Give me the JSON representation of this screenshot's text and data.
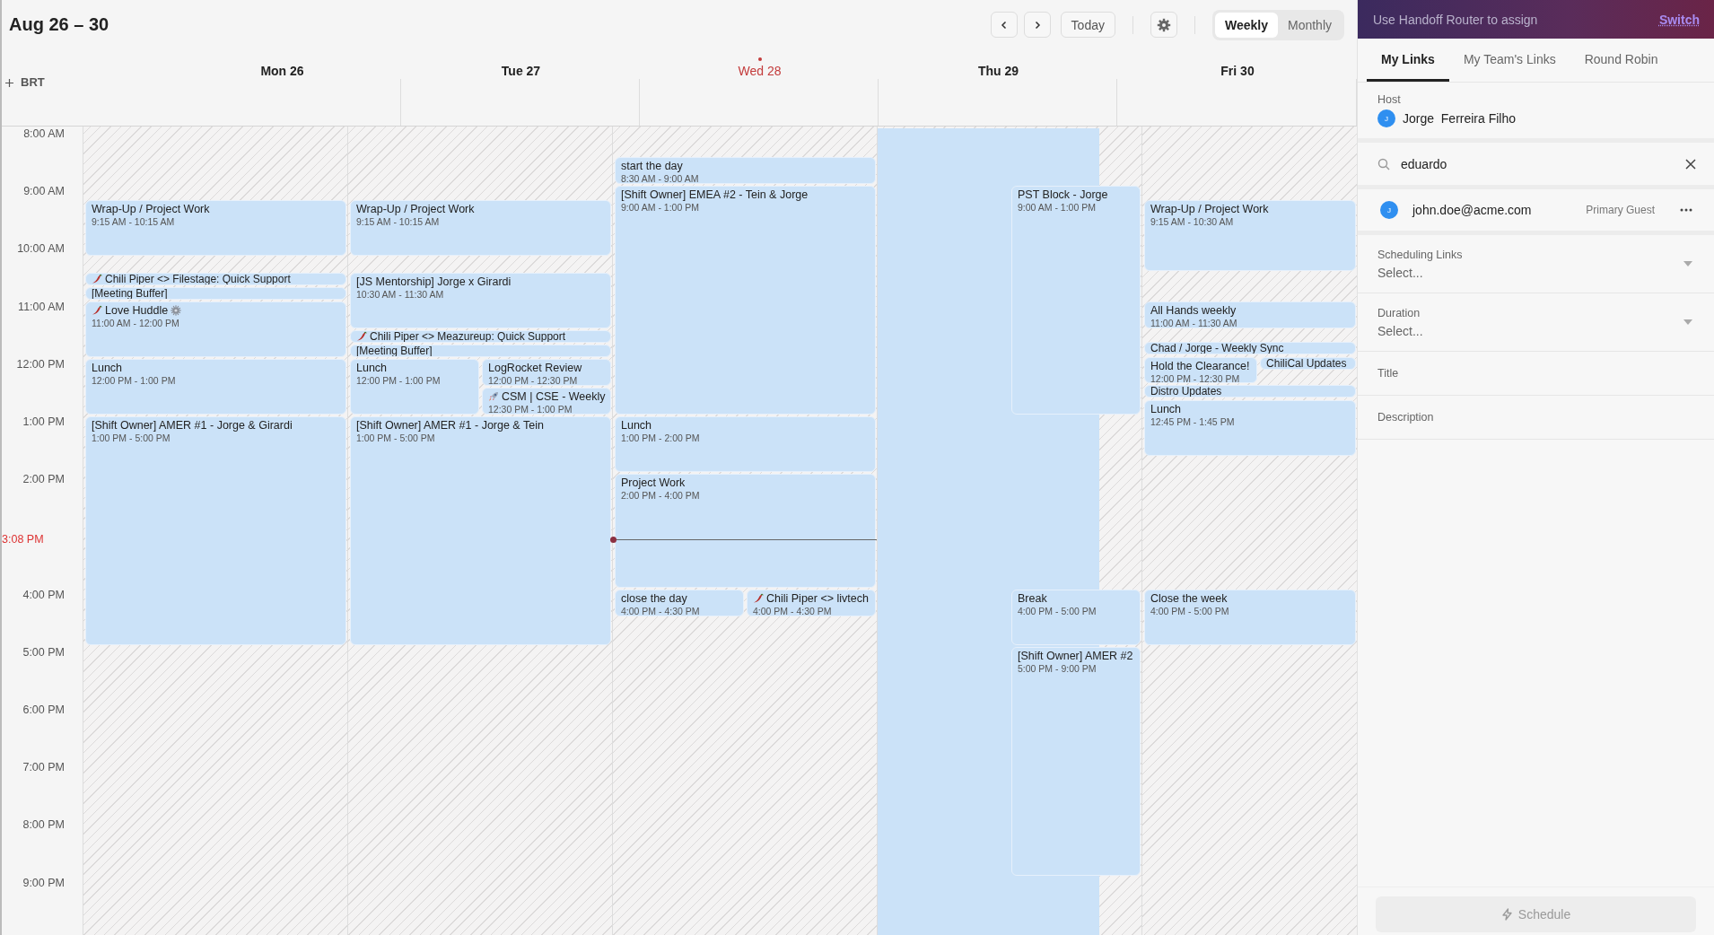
{
  "header": {
    "title": "Aug 26 – 30",
    "today_button": "Today",
    "views": [
      {
        "label": "Weekly",
        "selected": true
      },
      {
        "label": "Monthly",
        "selected": false
      }
    ]
  },
  "timezone": "BRT",
  "time_labels": [
    "8:00 AM",
    "9:00 AM",
    "10:00 AM",
    "11:00 AM",
    "12:00 PM",
    "1:00 PM",
    "2:00 PM",
    "4:00 PM",
    "5:00 PM",
    "6:00 PM",
    "7:00 PM",
    "8:00 PM",
    "9:00 PM"
  ],
  "now_indicator": {
    "label": "3:08 PM"
  },
  "days": [
    {
      "label": "Mon 26",
      "today": false,
      "events": [
        {
          "kind": "event",
          "title": "Wrap-Up / Project Work",
          "time": "9:15 AM - 10:15 AM"
        },
        {
          "kind": "chili_piper",
          "title": "Chili Piper <> Filestage: Quick Support"
        },
        {
          "kind": "event",
          "title": "[Meeting Buffer]"
        },
        {
          "kind": "chili_piper",
          "title": "Love Huddle",
          "badge": true,
          "time": "11:00 AM - 12:00 PM"
        },
        {
          "kind": "event",
          "title": "Lunch",
          "time": "12:00 PM - 1:00 PM"
        },
        {
          "kind": "event",
          "title": "[Shift Owner] AMER #1 - Jorge & Girardi",
          "time": "1:00 PM - 5:00 PM"
        }
      ]
    },
    {
      "label": "Tue 27",
      "today": false,
      "events": [
        {
          "kind": "event",
          "title": "Wrap-Up / Project Work",
          "time": "9:15 AM - 10:15 AM"
        },
        {
          "kind": "event",
          "title": "[JS Mentorship] Jorge x Girardi",
          "time": "10:30 AM - 11:30 AM"
        },
        {
          "kind": "chili_piper",
          "title": "Chili Piper <> Meazureup: Quick Support"
        },
        {
          "kind": "event",
          "title": "[Meeting Buffer]"
        },
        {
          "kind": "event",
          "title": "Lunch",
          "time": "12:00 PM - 1:00 PM"
        },
        {
          "kind": "event",
          "title": "LogRocket Review",
          "time": "12:00 PM - 12:30 PM"
        },
        {
          "kind": "rocket",
          "title": "CSM | CSE - Weekly",
          "time": "12:30 PM - 1:00 PM"
        },
        {
          "kind": "event",
          "title": "[Shift Owner] AMER #1 - Jorge & Tein",
          "time": "1:00 PM - 5:00 PM"
        }
      ]
    },
    {
      "label": "Wed 28",
      "today": true,
      "events": [
        {
          "kind": "event",
          "title": "start the day",
          "time": "8:30 AM - 9:00 AM"
        },
        {
          "kind": "event",
          "title": "[Shift Owner] EMEA #2 - Tein & Jorge",
          "time": "9:00 AM - 1:00 PM"
        },
        {
          "kind": "event",
          "title": "Lunch",
          "time": "1:00 PM - 2:00 PM"
        },
        {
          "kind": "event",
          "title": "Project Work",
          "time": "2:00 PM - 4:00 PM"
        },
        {
          "kind": "event",
          "title": "close the day",
          "time": "4:00 PM - 4:30 PM"
        },
        {
          "kind": "chili_piper",
          "title": "Chili Piper <> livtech",
          "time": "4:00 PM - 4:30 PM"
        }
      ]
    },
    {
      "label": "Thu 29",
      "today": false,
      "events": [
        {
          "kind": "block"
        },
        {
          "kind": "event",
          "title": "PST Block - Jorge",
          "time": "9:00 AM - 1:00 PM"
        },
        {
          "kind": "event",
          "title": "Break",
          "time": "4:00 PM - 5:00 PM"
        },
        {
          "kind": "event",
          "title": "[Shift Owner] AMER #2",
          "time": "5:00 PM - 9:00 PM"
        }
      ]
    },
    {
      "label": "Fri 30",
      "today": false,
      "events": [
        {
          "kind": "event",
          "title": "Wrap-Up / Project Work",
          "time": "9:15 AM - 10:30 AM"
        },
        {
          "kind": "event",
          "title": "All Hands weekly",
          "time": "11:00 AM - 11:30 AM"
        },
        {
          "kind": "event",
          "title": "Chad / Jorge - Weekly Sync"
        },
        {
          "kind": "event",
          "title": "Hold the Clearance!",
          "time": "12:00 PM - 12:30 PM"
        },
        {
          "kind": "event",
          "title": "ChiliCal Updates"
        },
        {
          "kind": "event",
          "title": "Distro Updates"
        },
        {
          "kind": "event",
          "title": "Lunch",
          "time": "12:45 PM - 1:45 PM"
        },
        {
          "kind": "event",
          "title": "Close the week",
          "time": "4:00 PM - 5:00 PM"
        }
      ]
    }
  ],
  "panel": {
    "banner": {
      "text": "Use Handoff Router to assign",
      "link": "Switch"
    },
    "tabs": [
      {
        "label": "My Links",
        "selected": true
      },
      {
        "label": "My Team's Links",
        "selected": false
      },
      {
        "label": "Round Robin",
        "selected": false
      }
    ],
    "host": {
      "label": "Host",
      "initial": "J",
      "name": "Jorge  Ferreira Filho"
    },
    "search": {
      "value": "eduardo"
    },
    "guests": [
      {
        "initial": "J",
        "email": "john.doe@acme.com",
        "role": "Primary Guest"
      }
    ],
    "fields": [
      {
        "kind": "select",
        "label": "Scheduling Links",
        "placeholder": "Select..."
      },
      {
        "kind": "select",
        "label": "Duration",
        "placeholder": "Select..."
      },
      {
        "kind": "text",
        "label": "Title"
      },
      {
        "kind": "text",
        "label": "Description"
      }
    ],
    "schedule_button": {
      "label": "Schedule",
      "disabled": true
    }
  }
}
